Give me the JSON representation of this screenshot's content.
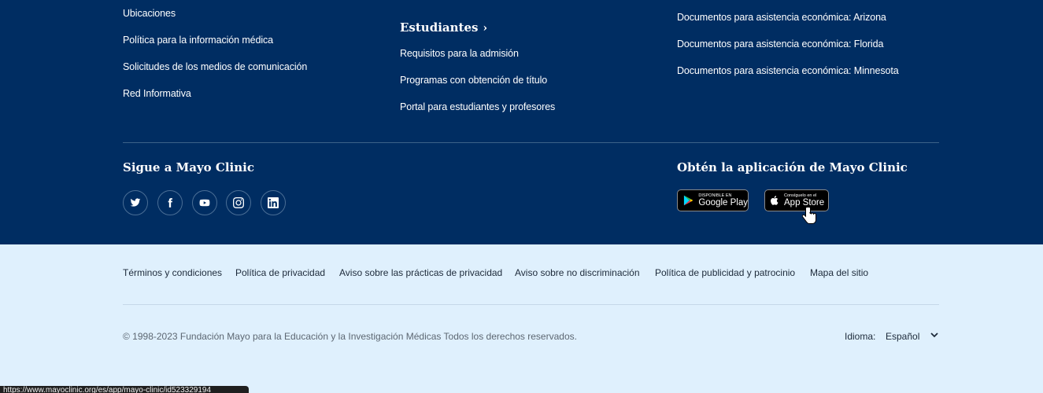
{
  "columns": {
    "col1": [
      "Ubicaciones",
      "Política para la información médica",
      "Solicitudes de los medios de comunicación",
      "Red Informativa"
    ],
    "col2": {
      "heading": "Estudiantes",
      "links": [
        "Requisitos para la admisión",
        "Programas con obtención de título",
        "Portal para estudiantes y profesores"
      ]
    },
    "col3": [
      "Documentos para asistencia económica: Arizona",
      "Documentos para asistencia económica: Florida",
      "Documentos para asistencia económica: Minnesota"
    ]
  },
  "social": {
    "heading": "Sigue a Mayo Clinic",
    "icons": [
      "twitter-icon",
      "facebook-icon",
      "youtube-icon",
      "instagram-icon",
      "linkedin-icon"
    ]
  },
  "app": {
    "heading": "Obtén la aplicación de Mayo Clinic",
    "google_play": {
      "small": "DISPONIBLE EN",
      "big": "Google Play"
    },
    "app_store": {
      "small": "Consíguelo en el",
      "big": "App Store"
    }
  },
  "legal_links": [
    "Términos y condiciones",
    "Política de privacidad",
    "Aviso sobre las prácticas de privacidad",
    "Aviso sobre no discriminación",
    "Política de publicidad y patrocinio",
    "Mapa del sitio"
  ],
  "copyright": "© 1998-2023 Fundación Mayo para la Educación y la Investigación Médicas Todos los derechos reservados.",
  "language": {
    "label": "Idioma:",
    "value": "Español"
  },
  "status_bar": "https://www.mayoclinic.org/es/app/mayo-clinic/id523329194",
  "colors": {
    "footer_bg": "#002d62",
    "legal_bg": "#dff0fd",
    "text_dark": "#1d2a3a"
  }
}
